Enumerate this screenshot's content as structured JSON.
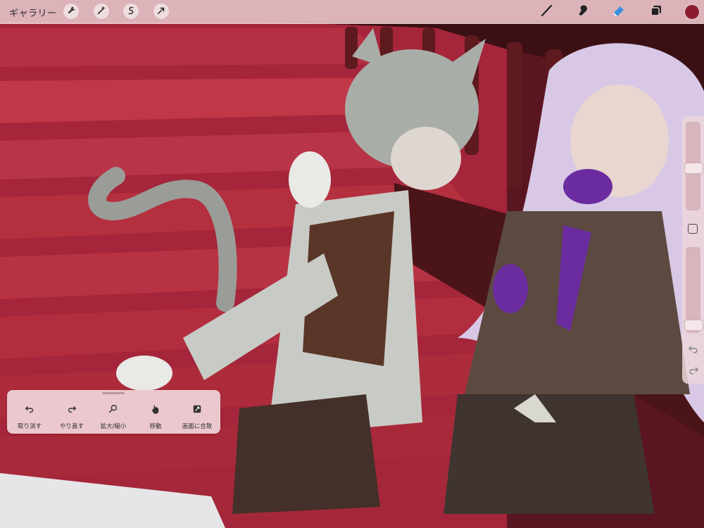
{
  "topbar": {
    "gallery_label": "ギャラリー",
    "left_tools": [
      {
        "icon": "wrench-icon"
      },
      {
        "icon": "magic-wand-icon"
      },
      {
        "icon": "selection-icon"
      },
      {
        "icon": "transform-arrow-icon"
      }
    ],
    "right_tools": [
      {
        "icon": "brush-icon"
      },
      {
        "icon": "smudge-icon"
      },
      {
        "icon": "eraser-icon"
      },
      {
        "icon": "layers-icon"
      }
    ],
    "current_color": "#8c1d2e"
  },
  "sidebar": {
    "brush_size_level": 0.48,
    "opacity_level": 0.05,
    "icons": [
      "modify-square-icon",
      "undo-icon",
      "redo-icon"
    ]
  },
  "quick_menu": {
    "items": [
      {
        "label": "取り消す",
        "icon": "undo-icon"
      },
      {
        "label": "やり直す",
        "icon": "redo-icon"
      },
      {
        "label": "拡大/縮小",
        "icon": "zoom-icon"
      },
      {
        "label": "移動",
        "icon": "hand-move-icon"
      },
      {
        "label": "画面に合致",
        "icon": "fit-screen-icon"
      }
    ]
  },
  "colors": {
    "stairs_light": "#b32a3b",
    "stairs_dark": "#7d1728",
    "accent_purple": "#6a2c9e",
    "hair_grey": "#a9ada8",
    "hair_lilac": "#d8c8e6"
  }
}
